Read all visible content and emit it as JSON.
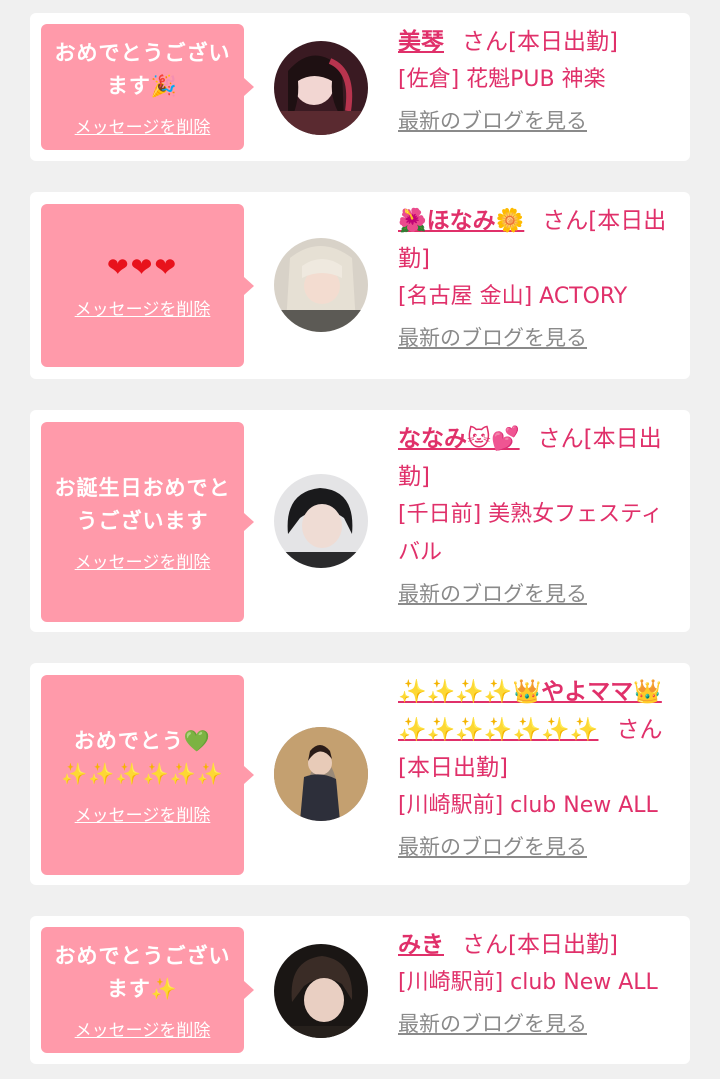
{
  "cards": [
    {
      "message": "おめでとうございます🎉",
      "delete_label": "メッセージを削除",
      "name": "美琴",
      "san_status": "さん[本日出勤]",
      "shop": "[佐倉] 花魁PUB 神楽",
      "blog_label": "最新のブログを見る"
    },
    {
      "message": "❤❤❤",
      "delete_label": "メッセージを削除",
      "name": "🌺ほなみ🌼",
      "san_status": "さん[本日出勤]",
      "shop": "[名古屋 金山] ACTORY",
      "blog_label": "最新のブログを見る"
    },
    {
      "message": "お誕生日おめでとうございます",
      "delete_label": "メッセージを削除",
      "name": "ななみ🐱💕",
      "san_status": "さん[本日出勤]",
      "shop": "[千日前] 美熟女フェスティバル",
      "blog_label": "最新のブログを見る"
    },
    {
      "message": "おめでとう💚",
      "message2": "✨✨✨✨✨✨",
      "delete_label": "メッセージを削除",
      "name": "✨✨✨✨👑やよママ👑✨✨✨✨✨✨✨",
      "san_status": "さん[本日出勤]",
      "shop": "[川崎駅前] club New ALL",
      "blog_label": "最新のブログを見る"
    },
    {
      "message": "おめでとうございます✨",
      "delete_label": "メッセージを削除",
      "name": "みき",
      "san_status": "さん[本日出勤]",
      "shop": "[川崎駅前] club New ALL",
      "blog_label": "最新のブログを見る"
    }
  ]
}
